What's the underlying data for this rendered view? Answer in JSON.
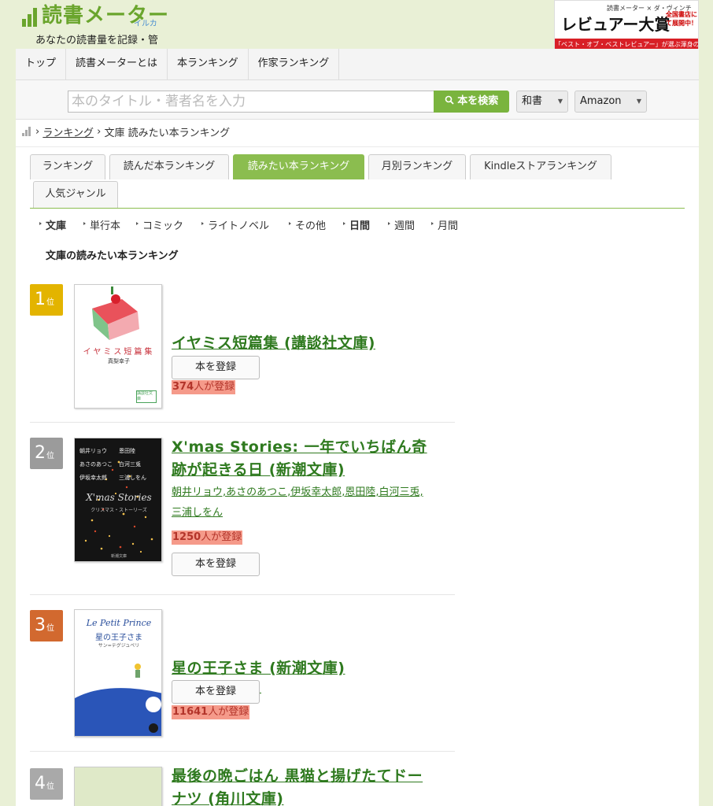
{
  "header": {
    "logo_text": "読書メーター",
    "logo_sub": "イルカ",
    "tagline": "あなたの読書量を記録・管",
    "banner": {
      "top": "読書メーター × ダ・ヴィンチ",
      "main": "レビュアー大賞",
      "side": "全国書店にて展開中！",
      "bottom": "「ベスト・オブ・ベストレビュアー」が選ぶ渾身の5冊"
    }
  },
  "topnav": [
    "トップ",
    "読書メーターとは",
    "本ランキング",
    "作家ランキング"
  ],
  "search": {
    "placeholder": "本のタイトル・著者名を入力",
    "button": "本を検索",
    "category": "和書",
    "store": "Amazon"
  },
  "breadcrumb": {
    "link": "ランキング",
    "current": "文庫 読みたい本ランキング"
  },
  "tabs": [
    "ランキング",
    "読んだ本ランキング",
    "読みたい本ランキング",
    "月別ランキング",
    "Kindleストアランキング",
    "人気ジャンル"
  ],
  "subnav": [
    "文庫",
    "単行本",
    "コミック",
    "ライトノベル",
    "その他",
    "日間",
    "週間",
    "月間"
  ],
  "section_title": "文庫の読みたい本ランキング",
  "colors": {
    "accent": "#7ab43e",
    "link": "#2f7a1f",
    "rank1": "#e3b400",
    "rank2": "#9b9b9b",
    "rank3": "#d2692f",
    "rank4": "#a9a9a9"
  },
  "books": [
    {
      "rank": "1",
      "rank_suffix": "位",
      "title": "イヤミス短篇集 (講談社文庫)",
      "author": "真梨幸子",
      "count": "374",
      "count_suffix": "人が登録",
      "register": "本を登録",
      "cover": {
        "title": "イヤミス短篇集",
        "author": "真梨幸子",
        "publisher": "講談社文庫"
      }
    },
    {
      "rank": "2",
      "rank_suffix": "位",
      "title": "X'mas Stories: 一年でいちばん奇跡が起きる日 (新潮文庫)",
      "author": "朝井リョウ,あさのあつこ,伊坂幸太郎,恩田陸,白河三兎,三浦しをん",
      "count": "1250",
      "count_suffix": "人が登録",
      "register": "本を登録",
      "cover": {
        "names": [
          "朝井リョウ",
          "恩田陸",
          "あさのあつこ",
          "白河三兎",
          "伊坂幸太郎",
          "三浦しをん"
        ],
        "script": "X'mas Stories",
        "sub": "クリスマス・ストーリーズ",
        "publisher": "新潮文庫"
      }
    },
    {
      "rank": "3",
      "rank_suffix": "位",
      "title": "星の王子さま (新潮文庫)",
      "author": "サン=テグジュペリ",
      "count": "11641",
      "count_suffix": "人が登録",
      "register": "本を登録",
      "cover": {
        "script": "Le Petit Prince",
        "title": "星の王子さま",
        "author": "サン=テグジュペリ"
      }
    },
    {
      "rank": "4",
      "rank_suffix": "位",
      "title": "最後の晩ごはん 黒猫と揚げたてドーナツ (角川文庫)"
    }
  ]
}
